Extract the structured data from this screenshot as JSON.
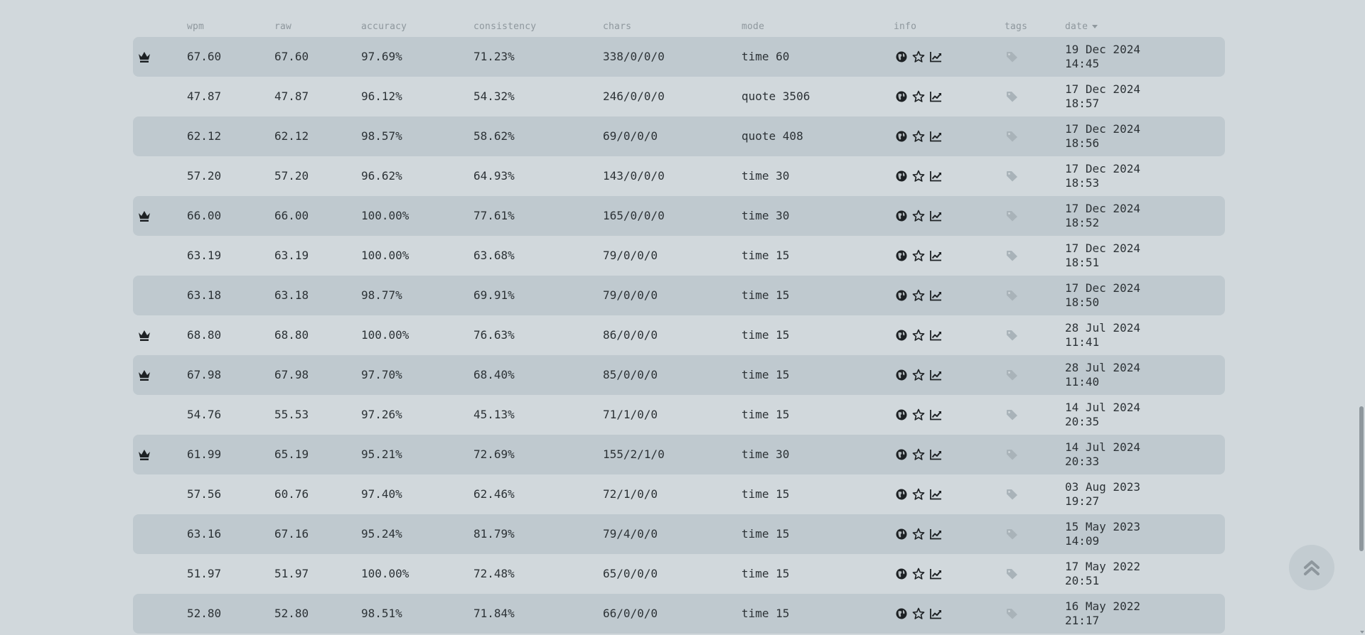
{
  "table": {
    "headers": {
      "wpm": "wpm",
      "raw": "raw",
      "accuracy": "accuracy",
      "consistency": "consistency",
      "chars": "chars",
      "mode": "mode",
      "info": "info",
      "tags": "tags",
      "date": "date"
    },
    "sort": {
      "column": "date",
      "direction": "descending"
    },
    "rows": [
      {
        "pb": true,
        "wpm": "67.60",
        "raw": "67.60",
        "accuracy": "97.69%",
        "consistency": "71.23%",
        "chars": "338/0/0/0",
        "mode": "time 60",
        "date": "19 Dec 2024",
        "time": "14:45"
      },
      {
        "pb": false,
        "wpm": "47.87",
        "raw": "47.87",
        "accuracy": "96.12%",
        "consistency": "54.32%",
        "chars": "246/0/0/0",
        "mode": "quote 3506",
        "date": "17 Dec 2024",
        "time": "18:57"
      },
      {
        "pb": false,
        "wpm": "62.12",
        "raw": "62.12",
        "accuracy": "98.57%",
        "consistency": "58.62%",
        "chars": "69/0/0/0",
        "mode": "quote 408",
        "date": "17 Dec 2024",
        "time": "18:56"
      },
      {
        "pb": false,
        "wpm": "57.20",
        "raw": "57.20",
        "accuracy": "96.62%",
        "consistency": "64.93%",
        "chars": "143/0/0/0",
        "mode": "time 30",
        "date": "17 Dec 2024",
        "time": "18:53"
      },
      {
        "pb": true,
        "wpm": "66.00",
        "raw": "66.00",
        "accuracy": "100.00%",
        "consistency": "77.61%",
        "chars": "165/0/0/0",
        "mode": "time 30",
        "date": "17 Dec 2024",
        "time": "18:52"
      },
      {
        "pb": false,
        "wpm": "63.19",
        "raw": "63.19",
        "accuracy": "100.00%",
        "consistency": "63.68%",
        "chars": "79/0/0/0",
        "mode": "time 15",
        "date": "17 Dec 2024",
        "time": "18:51"
      },
      {
        "pb": false,
        "wpm": "63.18",
        "raw": "63.18",
        "accuracy": "98.77%",
        "consistency": "69.91%",
        "chars": "79/0/0/0",
        "mode": "time 15",
        "date": "17 Dec 2024",
        "time": "18:50"
      },
      {
        "pb": true,
        "wpm": "68.80",
        "raw": "68.80",
        "accuracy": "100.00%",
        "consistency": "76.63%",
        "chars": "86/0/0/0",
        "mode": "time 15",
        "date": "28 Jul 2024",
        "time": "11:41"
      },
      {
        "pb": true,
        "wpm": "67.98",
        "raw": "67.98",
        "accuracy": "97.70%",
        "consistency": "68.40%",
        "chars": "85/0/0/0",
        "mode": "time 15",
        "date": "28 Jul 2024",
        "time": "11:40"
      },
      {
        "pb": false,
        "wpm": "54.76",
        "raw": "55.53",
        "accuracy": "97.26%",
        "consistency": "45.13%",
        "chars": "71/1/0/0",
        "mode": "time 15",
        "date": "14 Jul 2024",
        "time": "20:35"
      },
      {
        "pb": true,
        "wpm": "61.99",
        "raw": "65.19",
        "accuracy": "95.21%",
        "consistency": "72.69%",
        "chars": "155/2/1/0",
        "mode": "time 30",
        "date": "14 Jul 2024",
        "time": "20:33"
      },
      {
        "pb": false,
        "wpm": "57.56",
        "raw": "60.76",
        "accuracy": "97.40%",
        "consistency": "62.46%",
        "chars": "72/1/0/0",
        "mode": "time 15",
        "date": "03 Aug 2023",
        "time": "19:27"
      },
      {
        "pb": false,
        "wpm": "63.16",
        "raw": "67.16",
        "accuracy": "95.24%",
        "consistency": "81.79%",
        "chars": "79/4/0/0",
        "mode": "time 15",
        "date": "15 May 2023",
        "time": "14:09"
      },
      {
        "pb": false,
        "wpm": "51.97",
        "raw": "51.97",
        "accuracy": "100.00%",
        "consistency": "72.48%",
        "chars": "65/0/0/0",
        "mode": "time 15",
        "date": "17 May 2022",
        "time": "20:51"
      },
      {
        "pb": false,
        "wpm": "52.80",
        "raw": "52.80",
        "accuracy": "98.51%",
        "consistency": "71.84%",
        "chars": "66/0/0/0",
        "mode": "time 15",
        "date": "16 May 2022",
        "time": "21:17"
      }
    ],
    "row_icons": [
      "crown-icon",
      "globe-icon",
      "star-icon",
      "chart-line-icon",
      "tag-icon"
    ]
  },
  "scroll_top_button": {
    "icon": "double-chevron-up-icon"
  },
  "colors": {
    "background": "#d1d8dc",
    "row_alt": "#bfc9cf",
    "text": "#2c3236",
    "muted": "#8e979d"
  }
}
